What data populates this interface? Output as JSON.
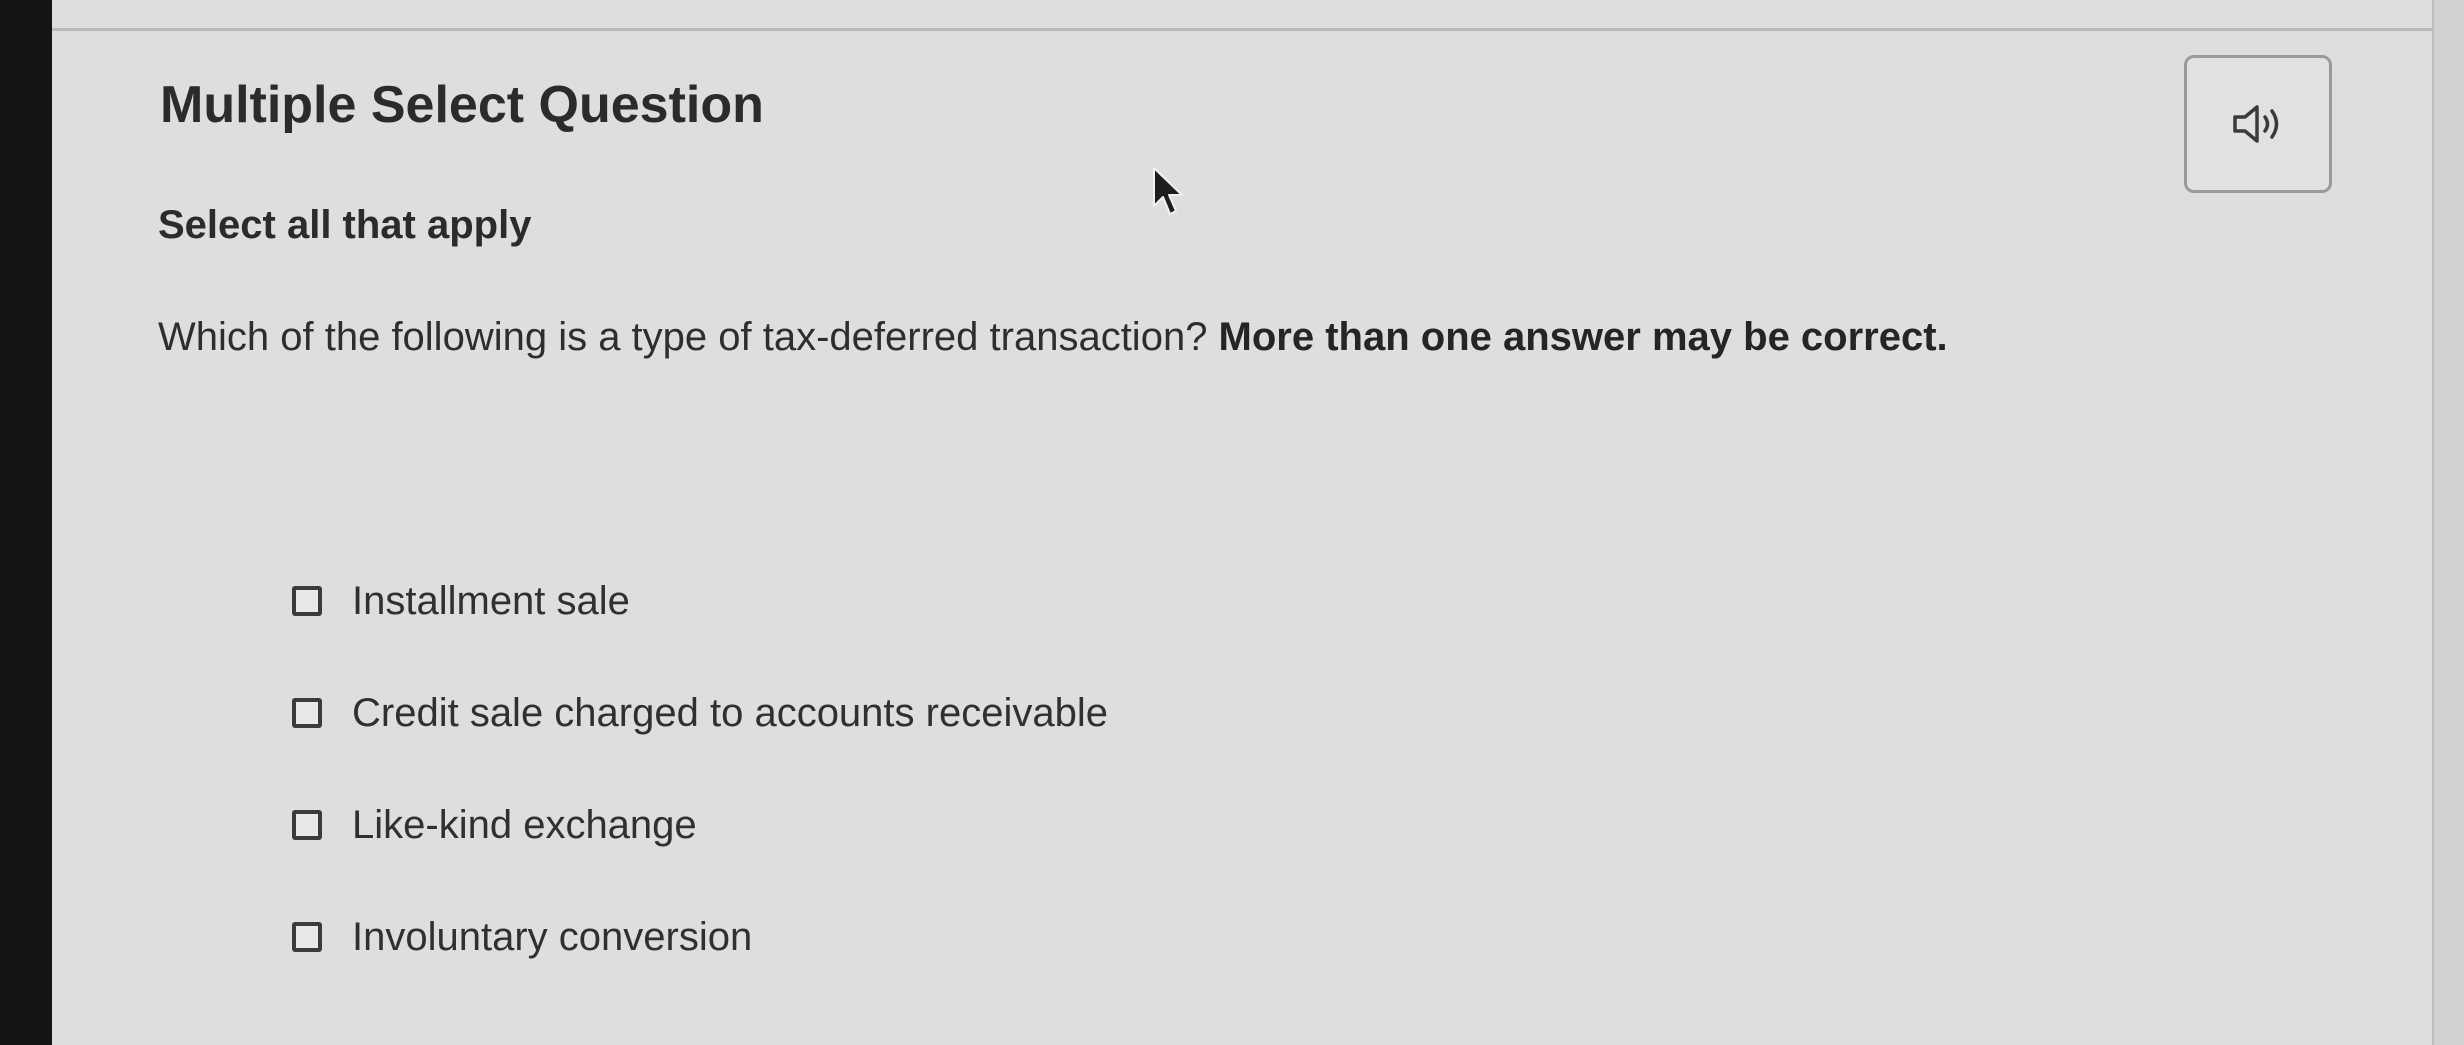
{
  "question": {
    "type_label": "Multiple Select Question",
    "instruction": "Select all that apply",
    "prompt_text": "Which of the following is a type of tax-deferred transaction? ",
    "prompt_emphasis": "More than one answer may be correct."
  },
  "audio_button": {
    "icon": "speaker-icon"
  },
  "options": [
    {
      "label": "Installment sale",
      "checked": false
    },
    {
      "label": "Credit sale charged to accounts receivable",
      "checked": false
    },
    {
      "label": "Like-kind exchange",
      "checked": false
    },
    {
      "label": "Involuntary conversion",
      "checked": false
    }
  ],
  "colors": {
    "background": "#dedede",
    "text": "#2b2b2b",
    "border": "#9a9a9a"
  }
}
